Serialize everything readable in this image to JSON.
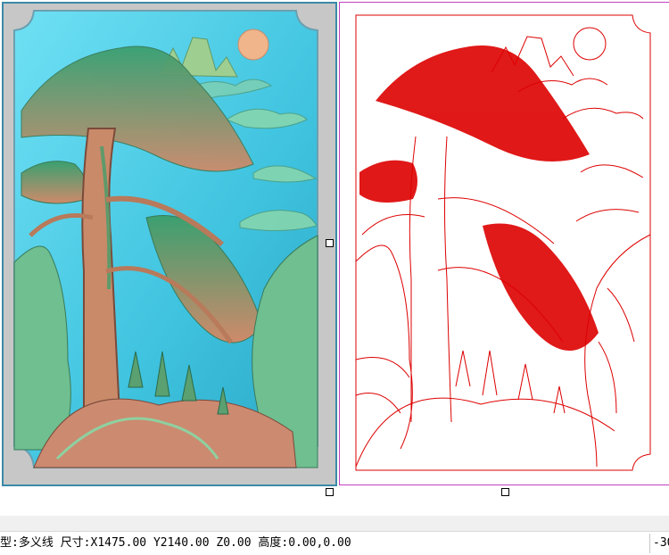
{
  "colors": {
    "relief_bg": "#58cde8",
    "relief_frame": "#c7c7c7",
    "relief_border": "#3a8aa8",
    "vector_line": "#dd0000",
    "vector_frame": "#c040c0"
  },
  "panels": {
    "relief": {
      "icon": "relief-3d-preview"
    },
    "vector": {
      "icon": "polyline-vector-drawing"
    }
  },
  "status": {
    "type_label": "型:",
    "type_value": "多义线",
    "size_label": "尺寸:",
    "x_value": "X1475.00",
    "y_value": "Y2140.00",
    "z_value": "Z0.00",
    "height_label": "高度:",
    "height_value": "0.00,0.00",
    "right_value": "-30"
  }
}
